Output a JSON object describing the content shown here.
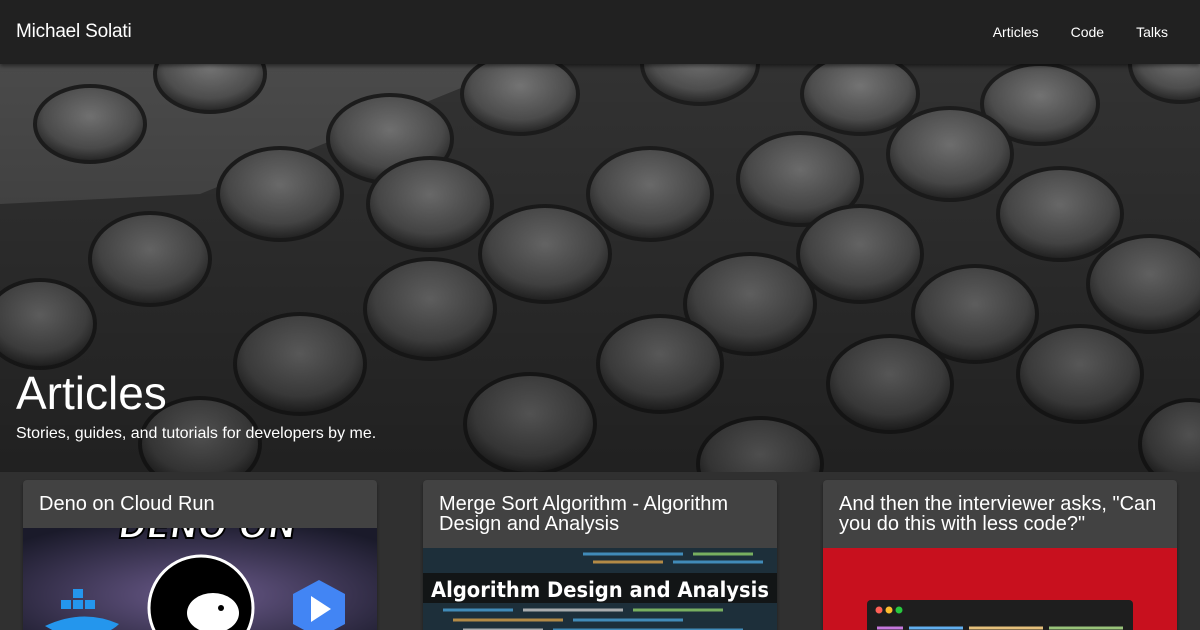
{
  "header": {
    "brand": "Michael Solati",
    "nav": [
      "Articles",
      "Code",
      "Talks"
    ]
  },
  "hero": {
    "title": "Articles",
    "subtitle": "Stories, guides, and tutorials for developers by me."
  },
  "cards": [
    {
      "title": "Deno on Cloud Run",
      "thumb_text": "DENO ON"
    },
    {
      "title": "Merge Sort Algorithm - Algorithm Design and Analysis",
      "thumb_text": "Algorithm Design and Analysis"
    },
    {
      "title": "And then the interviewer asks, \"Can you do this with less code?\""
    }
  ],
  "colors": {
    "topbar": "#212121",
    "card": "#424242",
    "red_thumb": "#c8101e"
  }
}
